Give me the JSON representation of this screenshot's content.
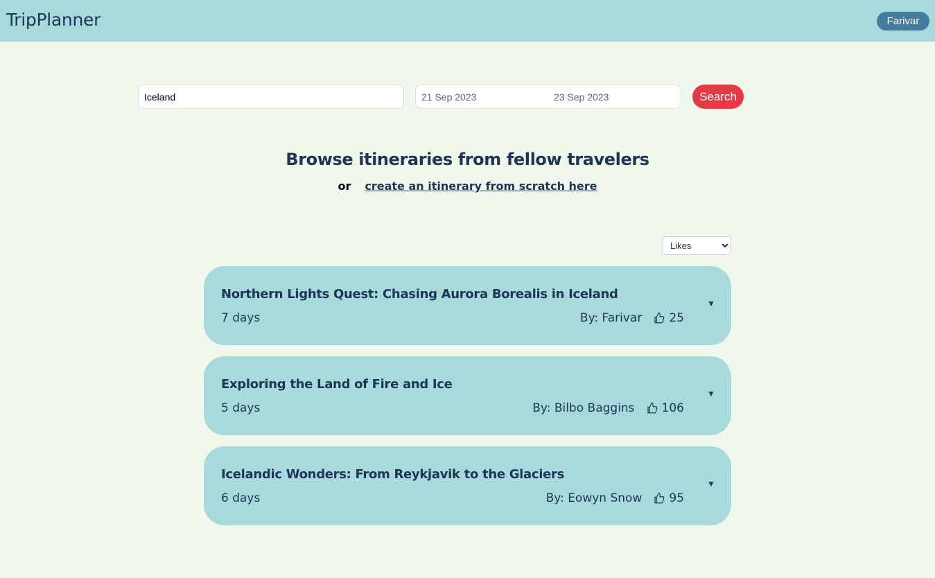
{
  "header": {
    "brand": "TripPlanner",
    "user_label": "Farivar"
  },
  "search": {
    "destination": "Iceland",
    "start_date": "21 Sep 2023",
    "end_date": "23 Sep 2023",
    "button_label": "Search"
  },
  "intro": {
    "heading": "Browse itineraries from fellow travelers",
    "or_text": "or",
    "create_link": "create an itinerary from scratch here"
  },
  "sort": {
    "selected": "Likes"
  },
  "itineraries": [
    {
      "title": "Northern Lights Quest: Chasing Aurora Borealis in Iceland",
      "duration": "7 days",
      "author": "By: Farivar",
      "likes": "25"
    },
    {
      "title": "Exploring the Land of Fire and Ice",
      "duration": "5 days",
      "author": "By: Bilbo Baggins",
      "likes": "106"
    },
    {
      "title": "Icelandic Wonders: From Reykjavik to the Glaciers",
      "duration": "6 days",
      "author": "By: Eowyn Snow",
      "likes": "95"
    }
  ],
  "colors": {
    "topbar": "#a8dadc",
    "background": "#f0f8ee",
    "primary_text": "#1d3557",
    "user_button": "#457b9d",
    "search_button": "#e63946",
    "card": "#a8dadc"
  },
  "icons": {
    "like": "thumbs-up-icon",
    "expand": "chevron-down-icon"
  }
}
